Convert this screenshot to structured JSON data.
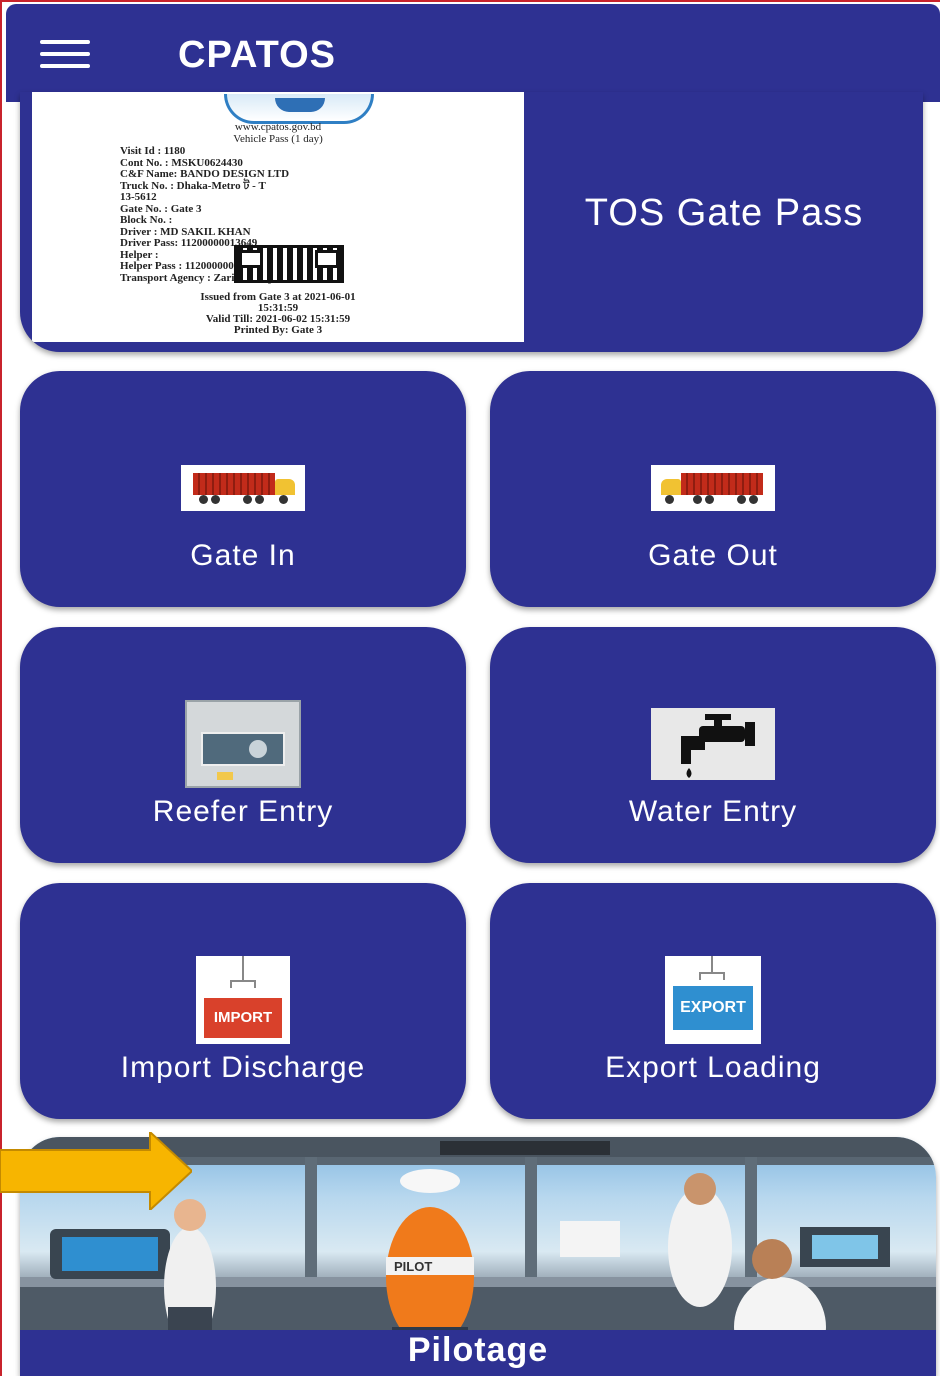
{
  "app_bar": {
    "title": "CPATOS",
    "menu_icon": "hamburger-menu-icon"
  },
  "tos_card": {
    "label": "TOS Gate Pass",
    "pass": {
      "website": "www.cpatos.gov.bd",
      "pass_type": "Vehicle Pass (1 day)",
      "lines": [
        "Visit Id : 1180",
        "Cont No. : MSKU0624430",
        "C&F Name:   BANDO DESIGN LTD",
        "Truck No. : Dhaka-Metro ট - T",
        "13-5612",
        "Gate No. : Gate 3",
        "Block No. :",
        "Driver : MD SAKIL KHAN",
        "Driver Pass: 11200000013649",
        "Helper :",
        "Helper Pass : 11200000034037",
        "Transport Agency : Zarif Transport"
      ],
      "issued": "Issued from Gate 3 at 2021-06-01",
      "issued_time": "15:31:59",
      "valid": "Valid Till: 2021-06-02 15:31:59",
      "printed": "Printed By: Gate 3"
    }
  },
  "menu": {
    "gate_in": {
      "label": "Gate In",
      "icon": "truck-icon"
    },
    "gate_out": {
      "label": "Gate Out",
      "icon": "truck-icon"
    },
    "reefer_entry": {
      "label": "Reefer Entry",
      "icon": "reefer-container-icon"
    },
    "water_entry": {
      "label": "Water Entry",
      "icon": "water-tap-icon"
    },
    "import_discharge": {
      "label": "Import Discharge",
      "icon": "import-container-icon",
      "icon_text": "IMPORT"
    },
    "export_loading": {
      "label": "Export Loading",
      "icon": "export-container-icon",
      "icon_text": "EXPORT"
    },
    "pilotage": {
      "label": "Pilotage",
      "icon": "ship-bridge-image",
      "badge_text": "PILOT"
    }
  },
  "colors": {
    "primary": "#2e3192",
    "arrow": "#f7b500",
    "import": "#d9412b",
    "export": "#2f8fd0"
  }
}
